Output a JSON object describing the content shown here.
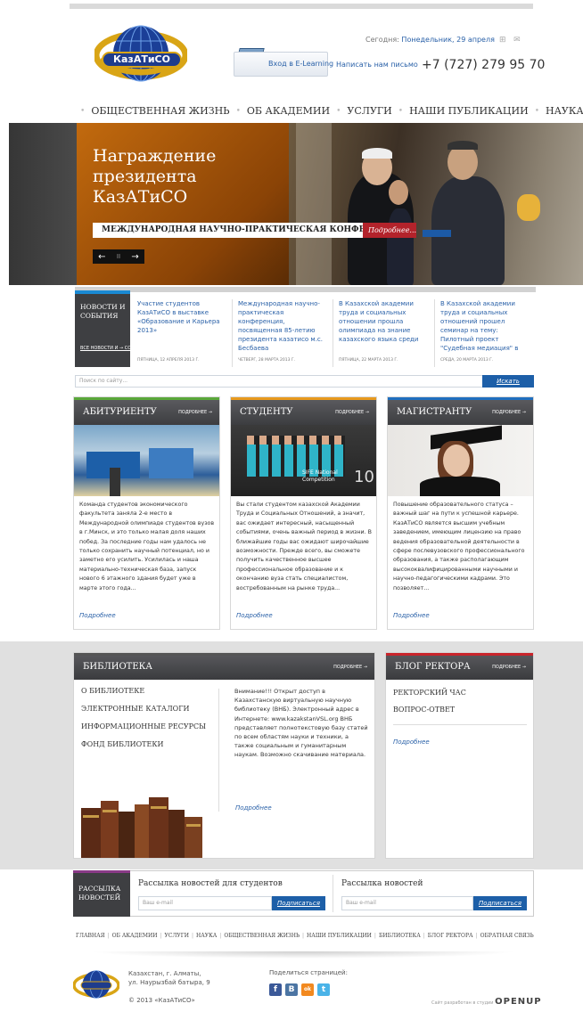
{
  "header": {
    "logo_text": "КазАТиСО",
    "today_label": "Сегодня:",
    "today_value": "Понедельник, 29 апреля",
    "elearning_label": "Вход в E-Learning",
    "write_label": "Написать нам письмо",
    "phone": "+7 (727) 279 95 70"
  },
  "nav": [
    "ОБЩЕСТВЕННАЯ ЖИЗНЬ",
    "ОБ АКАДЕМИИ",
    "УСЛУГИ",
    "НАШИ ПУБЛИКАЦИИ",
    "НАУКА"
  ],
  "hero": {
    "title": "Награждение президента КазАТиСО",
    "caption": "МЕЖДУНАРОДНАЯ НАУЧНО-ПРАКТИЧЕСКАЯ КОНФЕРЕНЦИЯ",
    "more": "Подробнее...",
    "prev": "←",
    "pause": "II",
    "next": "→"
  },
  "news": {
    "heading": "НОВОСТИ И СОБЫТИЯ",
    "all_link": "ВСЕ НОВОСТИ И → СОБЫТИЯ",
    "items": [
      {
        "text": "Участие студентов КазАТиСО в выставке «Образование и Карьера 2013»",
        "date": "ПЯТНИЦА, 12 АПРЕЛЯ 2013 Г."
      },
      {
        "text": "Международная научно-практическая конференция, посвященная 85-летию президента казатисо м.с. Бесбаева",
        "date": "ЧЕТВЕРГ, 28 МАРТА 2013 Г."
      },
      {
        "text": "В Казахской академии труда и социальных отношении прошла олимпиада на знание казахского языка среди",
        "date": "ПЯТНИЦА, 22 МАРТА 2013 Г."
      },
      {
        "text": "В Казахской академии труда и социальных отношений прошел семинар на тему: Пилотный проект \"Судебная медиация\" в",
        "date": "СРЕДА, 20 МАРТА 2013 Г."
      }
    ]
  },
  "search": {
    "placeholder": "Поиск по сайту...",
    "button": "Искать"
  },
  "cards": [
    {
      "title": "АБИТУРИЕНТУ",
      "more_top": "ПОДРОБНЕЕ →",
      "text": "Команда студентов экономического факультета заняла 2-е место в Международной олимпиаде студентов вузов в г.Минск, и это только малая доля наших побед. За последние годы нам удалось не только сохранить научный потенциал, но и заметно его усилить. Усилилась и наша материально-техническая база, запуск нового 6 этажного здания будет уже в марте этого года...",
      "more": "Подробнее",
      "accent": "#5aa83a"
    },
    {
      "title": "СТУДЕНТУ",
      "more_top": "ПОДРОБНЕЕ →",
      "text": "Вы стали студентом казахской Академии Труда и Социальных Отношений, а значит, вас ожидает интересный, насыщенный событиями, очень важный период в жизни. В ближайшие годы вас ожидают широчайшие возможности. Прежде всего, вы сможете получить качественное высшее профессиональное образование и к окончанию вуза стать специалистом, востребованным на рынке труда...",
      "more": "Подробнее",
      "accent": "#e89a1e",
      "photo_label": "SIFE National Competition",
      "photo_number": "10"
    },
    {
      "title": "МАГИСТРАНТУ",
      "more_top": "ПОДРОБНЕЕ →",
      "text": "Повышение образовательного статуса – важный шаг на пути к успешной карьере. КазАТиСО является высшим учебным заведением, имеющим лицензию на право ведения образовательной деятельности в сфере послевузовского профессионального образования, а также располагающим высококвалифицированными научными и научно-педагогическими кадрами. Это позволяет...",
      "more": "Подробнее",
      "accent": "#1f6fbf"
    }
  ],
  "library": {
    "title": "БИБЛИОТЕКА",
    "more_top": "ПОДРОБНЕЕ →",
    "menu": [
      "О БИБЛИОТЕКЕ",
      "ЭЛЕКТРОННЫЕ КАТАЛОГИ",
      "ИНФОРМАЦИОННЫЕ РЕСУРСЫ",
      "ФОНД БИБЛИОТЕКИ"
    ],
    "text": "Внимание!!! Открыт доступ в Казахстанскую виртуальную научную библиотеку (ВНБ). Электронный адрес в Интернете: www.kazakstanVSL.org ВНБ представляет полнотекстовую базу статей по всем областям науки и техники, а также социальным и гуманитарным наукам. Возможно скачивание материала.",
    "more": "Подробнее",
    "accent": "#555555"
  },
  "blog": {
    "title": "БЛОГ РЕКТОРА",
    "more_top": "ПОДРОБНЕЕ →",
    "menu": [
      "РЕКТОРСКИЙ ЧАС",
      "ВОПРОС-ОТВЕТ"
    ],
    "more": "Подробнее",
    "accent": "#c9242b"
  },
  "subscribe": {
    "heading": "РАССЫЛКА НОВОСТЕЙ",
    "students_title": "Рассылка новостей для студентов",
    "general_title": "Рассылка новостей",
    "email_placeholder": "Ваш e-mail",
    "button": "Подписаться"
  },
  "footer": {
    "links": [
      "ГЛАВНАЯ",
      "ОБ АКАДЕМИИ",
      "УСЛУГИ",
      "НАУКА",
      "ОБЩЕСТВЕННАЯ ЖИЗНЬ",
      "НАШИ ПУБЛИКАЦИИ",
      "БИБЛИОТЕКА",
      "БЛОГ РЕКТОРА",
      "ОБРАТНАЯ СВЯЗЬ"
    ],
    "address_line1": "Казахстан, г. Алматы,",
    "address_line2": "ул. Наурызбай батыра, 9",
    "copyright": "© 2013 «КазАТиСО»",
    "share_label": "Поделиться страницей:",
    "social": [
      "f",
      "B",
      "ok",
      "t"
    ],
    "developer_label": "Сайт разработан в студии",
    "developer_name": "OPENUP"
  }
}
